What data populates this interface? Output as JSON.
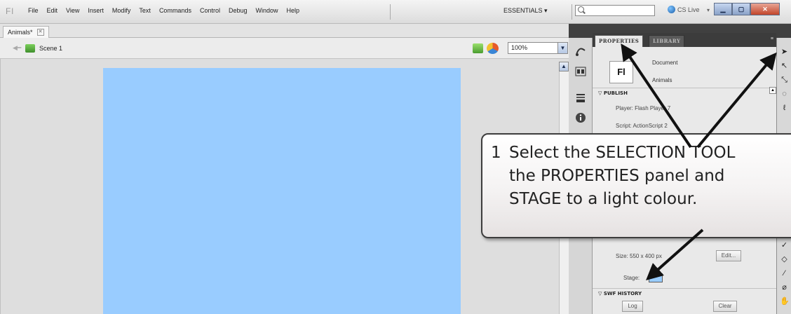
{
  "app": {
    "logo": "Fl",
    "menu": [
      "File",
      "Edit",
      "View",
      "Insert",
      "Modify",
      "Text",
      "Commands",
      "Control",
      "Debug",
      "Window",
      "Help"
    ],
    "workspace": "ESSENTIALS ▾",
    "search_placeholder": "",
    "cs_live": "CS Live",
    "window_controls": [
      "▁",
      "▢",
      "✕"
    ]
  },
  "document": {
    "tab_title": "Animals*",
    "tab_close": "✕",
    "scene_label": "Scene 1",
    "zoom": "100%"
  },
  "panel": {
    "tabs": [
      "PROPERTIES",
      "LIBRARY"
    ],
    "doc_icon": "Fl",
    "doc_type": "Document",
    "doc_name": "Animals",
    "publish_header": "PUBLISH",
    "player": "Player: Flash Player 7",
    "script": "Script: ActionScript 2",
    "size": "Size: 550 x 400 px",
    "edit_button": "Edit...",
    "stage_label": "Stage:",
    "stage_color": "#99ccff",
    "swf_header": "SWF HISTORY",
    "log_button": "Log",
    "clear_button": "Clear"
  },
  "callout": {
    "number": "1",
    "lines": [
      "Select the SELECTION TOOL",
      "the PROPERTIES panel and",
      "STAGE to a light colour."
    ]
  },
  "icons": {
    "strip": [
      "motion-editor-icon",
      "align-icon",
      "swatches-icon",
      "info-icon"
    ],
    "tools": [
      "selection-tool-icon",
      "subselection-tool-icon",
      "free-transform-tool-icon",
      "lasso-tool-icon",
      "pen-tool-icon",
      "ink-bottle-icon",
      "paint-bucket-icon",
      "eyedropper-icon",
      "eraser-icon",
      "hand-tool-icon"
    ]
  }
}
